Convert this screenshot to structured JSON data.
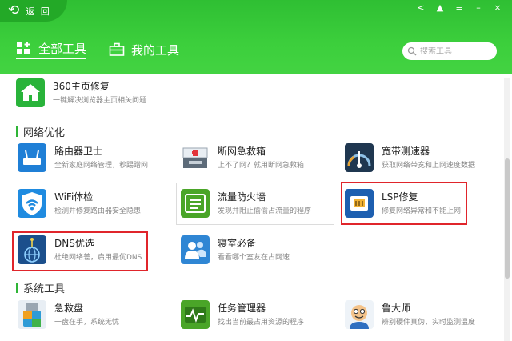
{
  "header": {
    "back_label": "返 回",
    "tabs": [
      {
        "label": "全部工具",
        "icon": "grid-plus-icon",
        "active": true
      },
      {
        "label": "我的工具",
        "icon": "toolbox-icon",
        "active": false
      }
    ],
    "search_placeholder": "搜索工具",
    "window_controls": [
      "share-icon",
      "shirt-icon",
      "menu-icon",
      "minimize-icon",
      "close-icon"
    ]
  },
  "top_item": {
    "title": "360主页修复",
    "desc": "一键解决浏览器主页相关问题",
    "icon": "home-repair-icon"
  },
  "sections": [
    {
      "title": "网络优化",
      "items": [
        {
          "title": "路由器卫士",
          "desc": "全新家庭网络管理，秒踢蹭网",
          "icon": "router-icon"
        },
        {
          "title": "断网急救箱",
          "desc": "上不了网？就用断网急救箱",
          "icon": "first-aid-kit-icon"
        },
        {
          "title": "宽带测速器",
          "desc": "获取网络带宽和上网速度数据",
          "icon": "speedometer-icon"
        },
        {
          "title": "WiFi体检",
          "desc": "检测并修复路由器安全隐患",
          "icon": "wifi-shield-icon"
        },
        {
          "title": "流量防火墙",
          "desc": "发现并阻止偷偷占流量的程序",
          "icon": "traffic-firewall-icon"
        },
        {
          "title": "LSP修复",
          "desc": "修复网络异常和不能上网",
          "icon": "lsp-chip-icon"
        },
        {
          "title": "DNS优选",
          "desc": "杜绝网络差，启用最优DNS",
          "icon": "dns-globe-icon"
        },
        {
          "title": "寝室必备",
          "desc": "看看哪个室友在占网速",
          "icon": "roommates-icon"
        }
      ]
    },
    {
      "title": "系统工具",
      "items": [
        {
          "title": "急救盘",
          "desc": "一盘在手，系统无忧",
          "icon": "usb-drive-icon"
        },
        {
          "title": "任务管理器",
          "desc": "找出当前最占用资源的程序",
          "icon": "task-manager-icon"
        },
        {
          "title": "鲁大师",
          "desc": "辨别硬件真伪，实时监测温度",
          "icon": "ludashi-icon"
        }
      ]
    }
  ],
  "colors": {
    "header_green": "#3ccf3c",
    "accent_green": "#2fb537",
    "highlight_red": "#e0252b"
  }
}
